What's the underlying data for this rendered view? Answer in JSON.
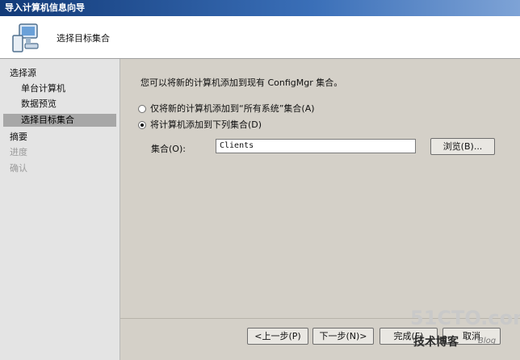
{
  "window": {
    "title": "导入计算机信息向导"
  },
  "header": {
    "title": "选择目标集合",
    "icon": "computer-wizard-icon"
  },
  "nav": {
    "items": [
      {
        "label": "选择源",
        "level": "top",
        "state": "normal"
      },
      {
        "label": "单台计算机",
        "level": "sub",
        "state": "normal"
      },
      {
        "label": "数据预览",
        "level": "sub",
        "state": "normal"
      },
      {
        "label": "选择目标集合",
        "level": "sub",
        "state": "active"
      },
      {
        "label": "摘要",
        "level": "top",
        "state": "normal"
      },
      {
        "label": "进度",
        "level": "top",
        "state": "disabled"
      },
      {
        "label": "确认",
        "level": "top",
        "state": "disabled"
      }
    ]
  },
  "main": {
    "intro": "您可以将新的计算机添加到现有 ConfigMgr 集合。",
    "option_all_systems": "仅将新的计算机添加到“所有系统”集合(A)",
    "option_collection": "将计算机添加到下列集合(D)",
    "selected_option": "collection",
    "collection_label": "集合(O):",
    "collection_value": "Clients",
    "browse_label": "浏览(B)..."
  },
  "footer": {
    "back_label": "<上一步(P)",
    "next_label": "下一步(N)>",
    "finish_label": "完成(F)",
    "cancel_label": "取消"
  },
  "watermark": {
    "site": "51CTO.com",
    "cn": "技术博客",
    "blog": "Blog"
  }
}
